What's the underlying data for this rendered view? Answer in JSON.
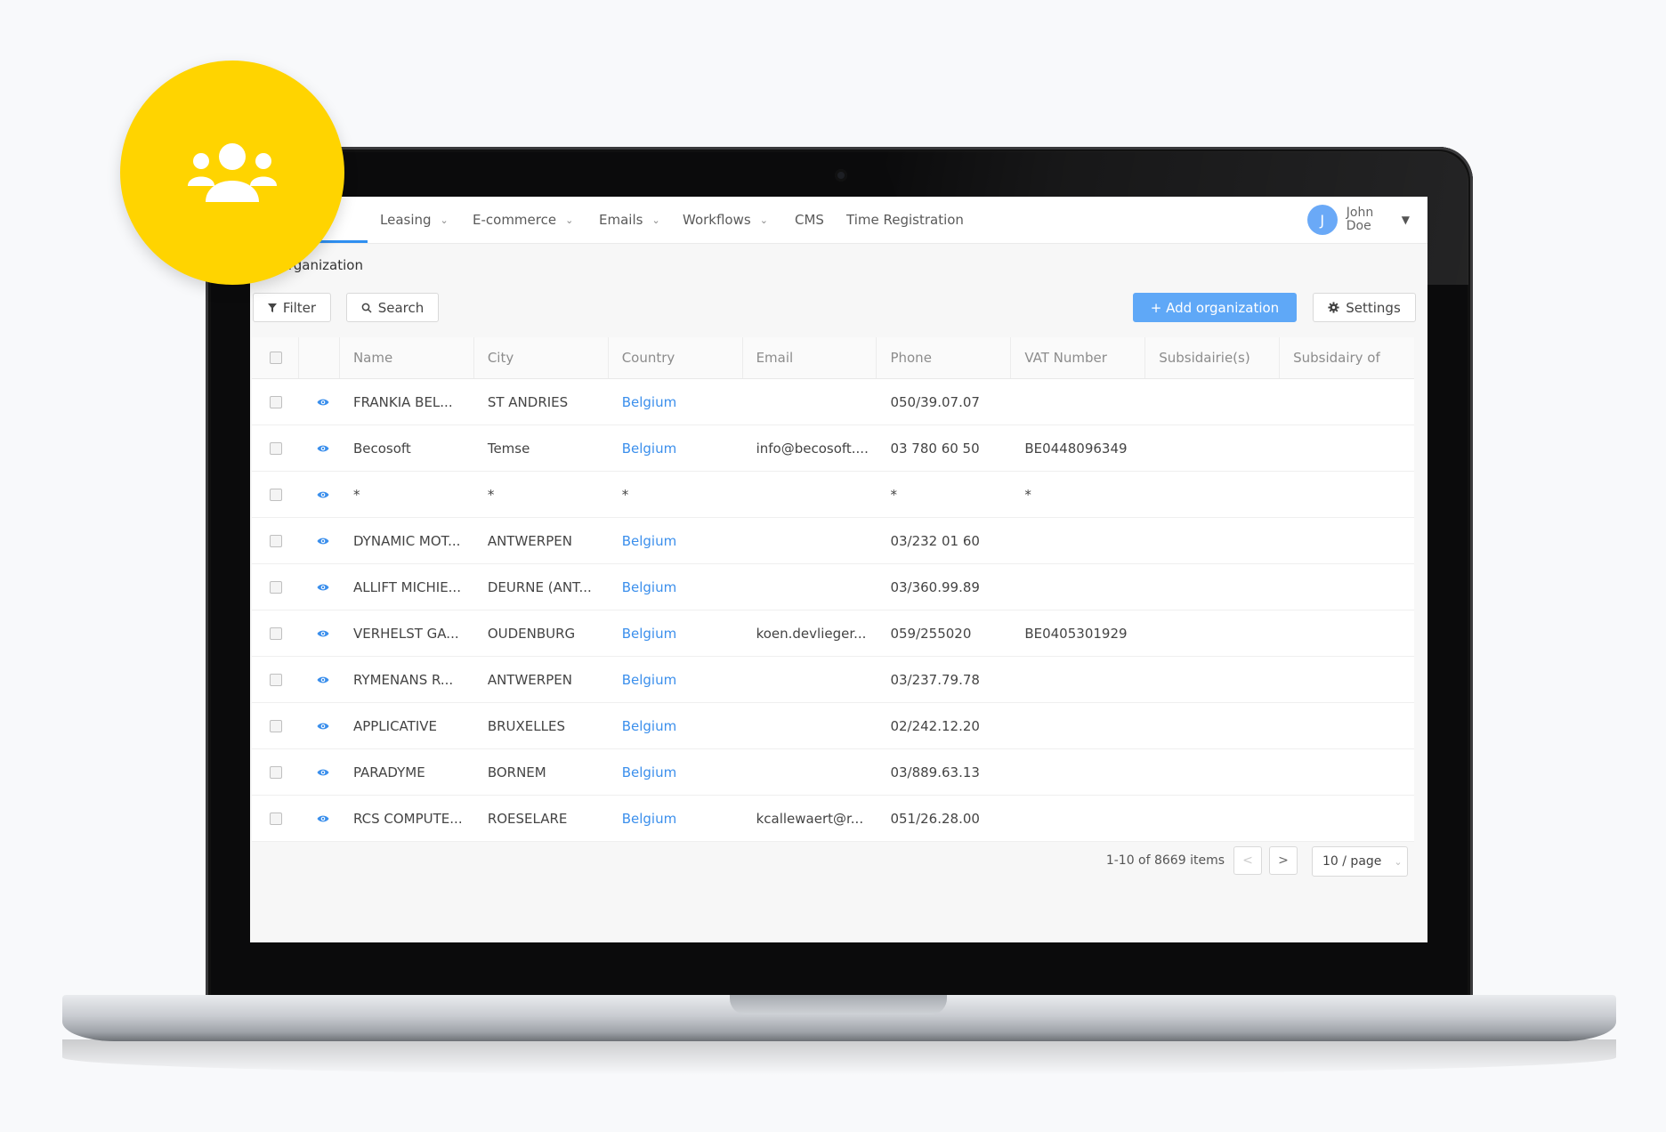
{
  "nav": {
    "items": [
      {
        "label": "Leasing"
      },
      {
        "label": "E-commerce"
      },
      {
        "label": "Emails"
      },
      {
        "label": "Workflows"
      },
      {
        "label": "CMS"
      },
      {
        "label": "Time Registration"
      }
    ],
    "user": {
      "initial": "J",
      "name": "John Doe"
    }
  },
  "breadcrumb": {
    "current": "Organization"
  },
  "toolbar": {
    "filter_label": "Filter",
    "search_label": "Search",
    "add_label": "+ Add organization",
    "settings_label": "Settings"
  },
  "table": {
    "columns": [
      "Name",
      "City",
      "Country",
      "Email",
      "Phone",
      "VAT Number",
      "Subsidairie(s)",
      "Subsidairy of"
    ],
    "rows": [
      {
        "name": "FRANKIA BEL...",
        "city": "ST ANDRIES",
        "country": "Belgium",
        "email": "",
        "phone": "050/39.07.07",
        "vat": "",
        "subs": "",
        "subof": ""
      },
      {
        "name": "Becosoft",
        "city": "Temse",
        "country": "Belgium",
        "email": "info@becosoft....",
        "phone": "03 780 60 50",
        "vat": "BE0448096349",
        "subs": "",
        "subof": ""
      },
      {
        "name": "*",
        "city": "*",
        "country": "*",
        "email": "",
        "phone": "*",
        "vat": "*",
        "subs": "",
        "subof": ""
      },
      {
        "name": "DYNAMIC MOT...",
        "city": "ANTWERPEN",
        "country": "Belgium",
        "email": "",
        "phone": "03/232 01 60",
        "vat": "",
        "subs": "",
        "subof": ""
      },
      {
        "name": "ALLIFT MICHIE...",
        "city": "DEURNE (ANT...",
        "country": "Belgium",
        "email": "",
        "phone": "03/360.99.89",
        "vat": "",
        "subs": "",
        "subof": ""
      },
      {
        "name": "VERHELST GA...",
        "city": "OUDENBURG",
        "country": "Belgium",
        "email": "koen.devlieger...",
        "phone": "059/255020",
        "vat": "BE0405301929",
        "subs": "",
        "subof": ""
      },
      {
        "name": "RYMENANS R...",
        "city": "ANTWERPEN",
        "country": "Belgium",
        "email": "",
        "phone": "03/237.79.78",
        "vat": "",
        "subs": "",
        "subof": ""
      },
      {
        "name": "APPLICATIVE",
        "city": "BRUXELLES",
        "country": "Belgium",
        "email": "",
        "phone": "02/242.12.20",
        "vat": "",
        "subs": "",
        "subof": ""
      },
      {
        "name": "PARADYME",
        "city": "BORNEM",
        "country": "Belgium",
        "email": "",
        "phone": "03/889.63.13",
        "vat": "",
        "subs": "",
        "subof": ""
      },
      {
        "name": "RCS COMPUTE...",
        "city": "ROESELARE",
        "country": "Belgium",
        "email": "kcallewaert@r...",
        "phone": "051/26.28.00",
        "vat": "",
        "subs": "",
        "subof": ""
      }
    ]
  },
  "pagination": {
    "summary": "1-10 of 8669 items",
    "prev": "<",
    "next": ">",
    "page_size": "10 / page"
  },
  "colors": {
    "accent": "#5fa8f7",
    "link": "#3b8fec",
    "badge": "#ffd400"
  },
  "icons": [
    "users-icon",
    "filter-icon",
    "search-icon",
    "gear-icon",
    "eye-icon",
    "chevron-down-icon"
  ]
}
